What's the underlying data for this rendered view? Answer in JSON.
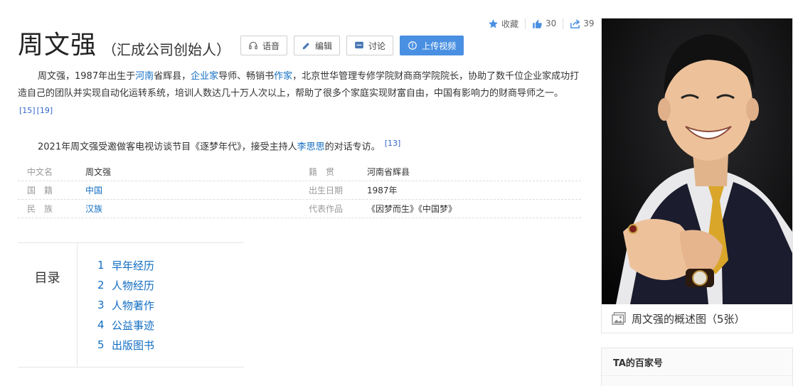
{
  "stats": {
    "favorite_label": "收藏",
    "likes": "30",
    "shares": "39"
  },
  "header": {
    "title": "周文强",
    "subtitle": "（汇成公司创始人）",
    "buttons": {
      "voice": "语音",
      "edit": "编辑",
      "discuss": "讨论",
      "upload_video": "上传视频"
    }
  },
  "summary": {
    "p1": {
      "s1": "周文强，1987年出生于",
      "l1": "河南",
      "s2": "省辉县，",
      "l2": "企业家",
      "s3": "导师、畅销书",
      "l3": "作家",
      "s4": "，北京世华管理专修学院财商商学院院长，协助了数千位企业家成功打造自己的团队并实现自动化运转系统，培训人数达几十万人次以上，帮助了很多个家庭实现财富自由，中国有影响力的财商导师之一。",
      "ref1": "[15]",
      "ref2": "[19]"
    },
    "p2": {
      "s1": "2021年周文强受邀做客电视访谈节目《逐梦年代》，接受主持人",
      "l1": "李思思",
      "s2": "的对话专访。",
      "ref1": "[13]"
    }
  },
  "info": [
    {
      "k1": "中文名",
      "v1": "周文强",
      "k2": "籍　贯",
      "v2": "河南省辉县"
    },
    {
      "k1": "国　籍",
      "v1": "中国",
      "k2": "出生日期",
      "v2": "1987年"
    },
    {
      "k1": "民　族",
      "v1": "汉族",
      "k2": "代表作品",
      "v2": "《因梦而生》《中国梦》"
    }
  ],
  "catalog": {
    "title": "目录",
    "items": [
      {
        "num": "1",
        "label": "早年经历"
      },
      {
        "num": "2",
        "label": "人物经历"
      },
      {
        "num": "3",
        "label": "人物著作"
      },
      {
        "num": "4",
        "label": "公益事迹"
      },
      {
        "num": "5",
        "label": "出版图书"
      }
    ]
  },
  "sidebar": {
    "album_caption": "周文强的概述图（5张）",
    "baijiahao_title": "TA的百家号"
  },
  "colors": {
    "link": "#136ec2",
    "primary_button": "#4a90e2",
    "tie": "#d9a62a"
  }
}
